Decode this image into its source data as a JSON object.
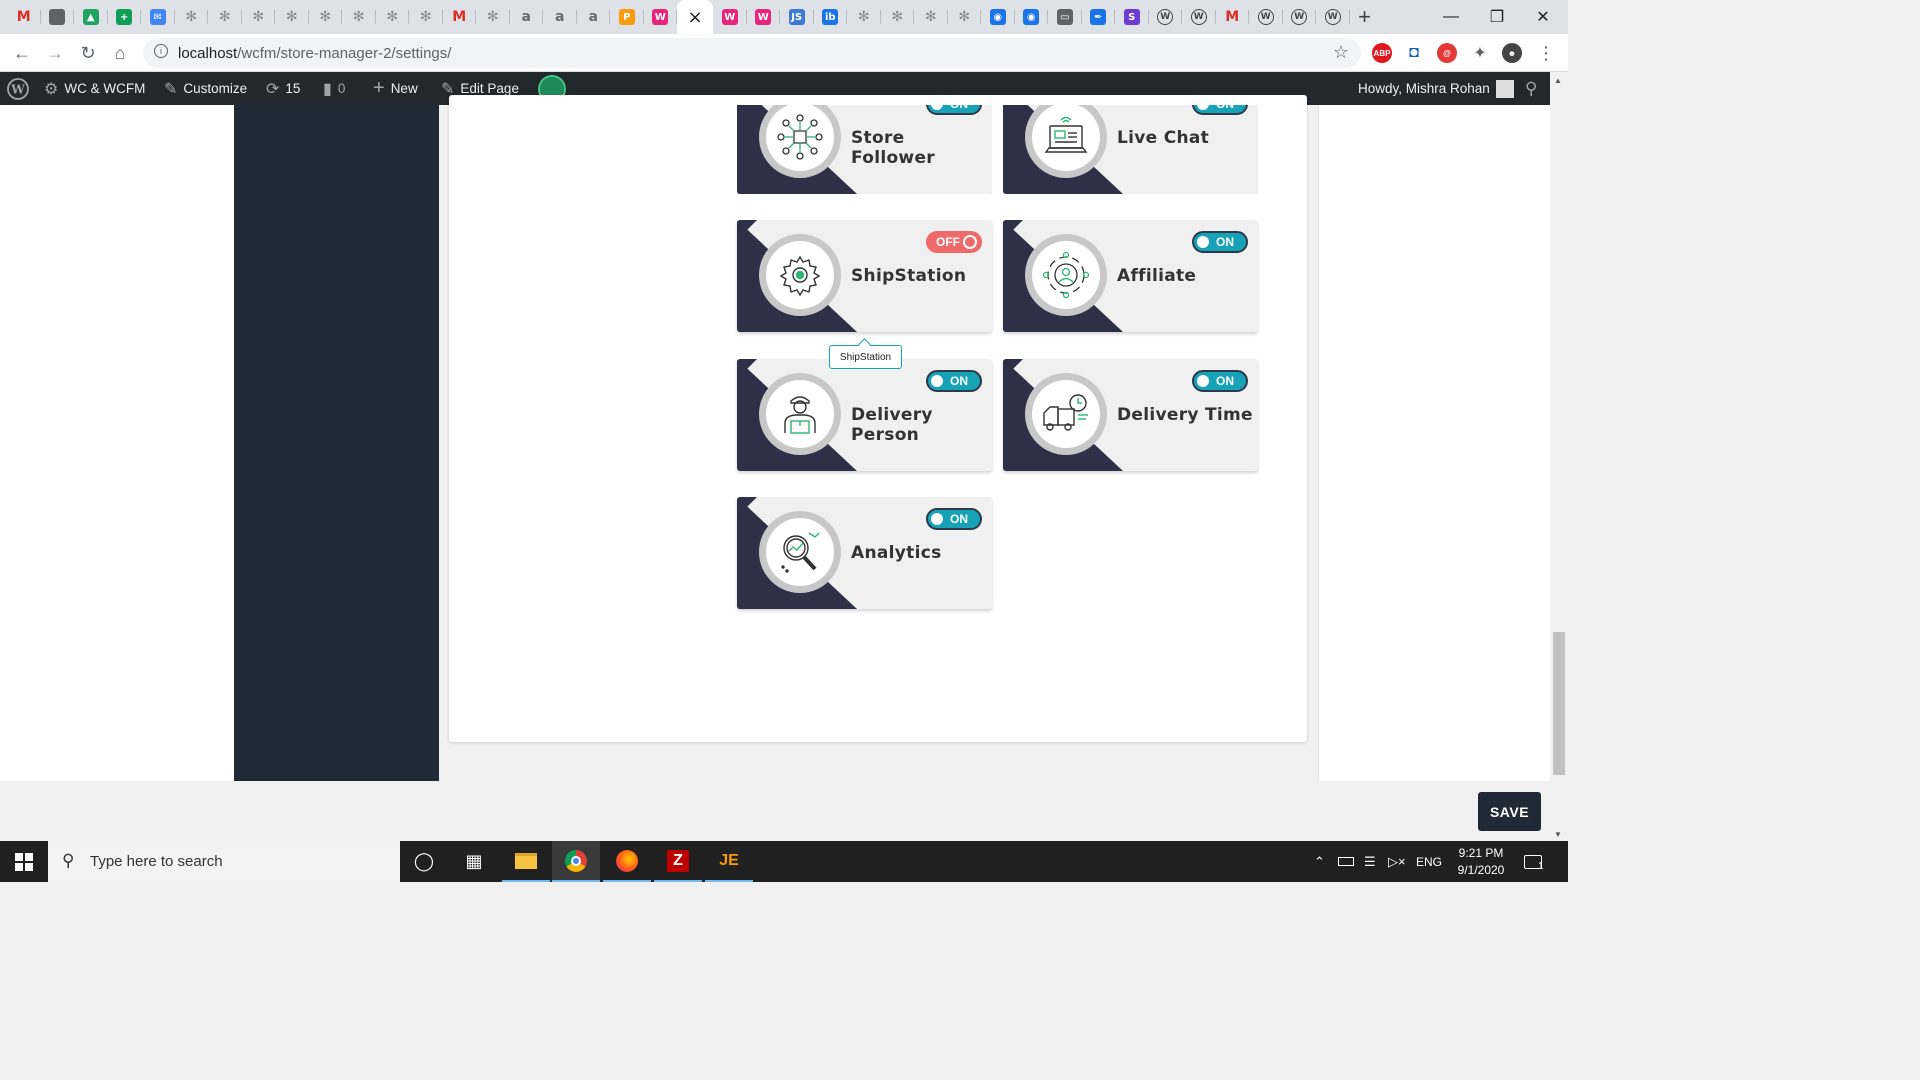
{
  "browser": {
    "tabs": [
      {
        "icon": "gmail-icon",
        "glyph": "M",
        "color": "#d93025"
      },
      {
        "icon": "circle-icon",
        "glyph": "",
        "color": "#5f6368"
      },
      {
        "icon": "drive-icon",
        "glyph": "▲",
        "color": "#1fa463"
      },
      {
        "icon": "sheets-icon",
        "glyph": "+",
        "color": "#0f9d58"
      },
      {
        "icon": "inbox-icon",
        "glyph": "✉",
        "color": "#4285f4"
      },
      {
        "icon": "site-icon",
        "glyph": "✻",
        "color": "#8b8b8b"
      },
      {
        "icon": "site-icon",
        "glyph": "✻",
        "color": "#8b8b8b"
      },
      {
        "icon": "site-icon",
        "glyph": "✻",
        "color": "#8b8b8b"
      },
      {
        "icon": "site-icon",
        "glyph": "✻",
        "color": "#8b8b8b"
      },
      {
        "icon": "site-icon",
        "glyph": "✻",
        "color": "#8b8b8b"
      },
      {
        "icon": "site-icon",
        "glyph": "✻",
        "color": "#8b8b8b"
      },
      {
        "icon": "site-icon",
        "glyph": "✻",
        "color": "#8b8b8b"
      },
      {
        "icon": "site-icon",
        "glyph": "✻",
        "color": "#8b8b8b"
      },
      {
        "icon": "gmail-icon",
        "glyph": "M",
        "color": "#d93025"
      },
      {
        "icon": "site-icon",
        "glyph": "✻",
        "color": "#8b8b8b"
      },
      {
        "icon": "script-a-icon",
        "glyph": "a",
        "color": "#6b6b6b"
      },
      {
        "icon": "script-a-icon",
        "glyph": "a",
        "color": "#6b6b6b"
      },
      {
        "icon": "script-a-icon",
        "glyph": "a",
        "color": "#6b6b6b"
      },
      {
        "icon": "phpmyadmin-icon",
        "glyph": "P",
        "color": "#f89c0e"
      },
      {
        "icon": "woo-icon",
        "glyph": "W",
        "color": "#e6267a"
      },
      {
        "icon": "close-icon",
        "glyph": "×",
        "color": "#202124",
        "active": true
      },
      {
        "icon": "woo-icon",
        "glyph": "W",
        "color": "#e6267a"
      },
      {
        "icon": "woo-icon",
        "glyph": "W",
        "color": "#e6267a"
      },
      {
        "icon": "js-icon",
        "glyph": "JS",
        "color": "#3c78d8"
      },
      {
        "icon": "ibb-icon",
        "glyph": "ib",
        "color": "#1a73e8"
      },
      {
        "icon": "site-icon",
        "glyph": "✻",
        "color": "#8b8b8b"
      },
      {
        "icon": "site-icon",
        "glyph": "✻",
        "color": "#8b8b8b"
      },
      {
        "icon": "site-icon",
        "glyph": "✻",
        "color": "#8b8b8b"
      },
      {
        "icon": "site-icon",
        "glyph": "✻",
        "color": "#8b8b8b"
      },
      {
        "icon": "globe-icon",
        "glyph": "◉",
        "color": "#1a73e8"
      },
      {
        "icon": "globe-icon",
        "glyph": "◉",
        "color": "#1a73e8"
      },
      {
        "icon": "screen-icon",
        "glyph": "▭",
        "color": "#5f6368"
      },
      {
        "icon": "feather-icon",
        "glyph": "✒",
        "color": "#1a73e8"
      },
      {
        "icon": "s-icon",
        "glyph": "S",
        "color": "#6c3bd1"
      },
      {
        "icon": "wordpress-icon",
        "glyph": "W",
        "color": "#464646"
      },
      {
        "icon": "wordpress-icon",
        "glyph": "W",
        "color": "#464646"
      },
      {
        "icon": "gmail-icon",
        "glyph": "M",
        "color": "#d93025"
      },
      {
        "icon": "wordpress-icon",
        "glyph": "W",
        "color": "#464646"
      },
      {
        "icon": "wordpress-icon",
        "glyph": "W",
        "color": "#464646"
      },
      {
        "icon": "wordpress-icon",
        "glyph": "W",
        "color": "#464646"
      }
    ],
    "url_host": "localhost",
    "url_path": "/wcfm/store-manager-2/settings/",
    "extensions": [
      {
        "icon": "adblock-icon",
        "glyph": "ABP",
        "color": "#e0181d"
      },
      {
        "icon": "camera-icon",
        "glyph": "◘",
        "color": "#1565c0"
      },
      {
        "icon": "spiral-icon",
        "glyph": "@",
        "color": "#e53935"
      },
      {
        "icon": "puzzle-icon",
        "glyph": "✦",
        "color": "#5f6368"
      },
      {
        "icon": "profile-avatar-icon",
        "glyph": "☻",
        "color": "#444"
      }
    ]
  },
  "adminbar": {
    "site": "WC & WCFM",
    "customize": "Customize",
    "updates": "15",
    "comments": "0",
    "new": "New",
    "edit": "Edit Page",
    "howdy": "Howdy, Mishra Rohan"
  },
  "modules": [
    {
      "title": "Store Follower",
      "state": "ON",
      "icon": "store-follower-icon"
    },
    {
      "title": "Live Chat",
      "state": "ON",
      "icon": "live-chat-icon"
    },
    {
      "title": "ShipStation",
      "state": "OFF",
      "icon": "shipstation-gear-icon"
    },
    {
      "title": "Affiliate",
      "state": "ON",
      "icon": "affiliate-icon"
    },
    {
      "title": "Delivery Person",
      "state": "ON",
      "icon": "delivery-person-icon"
    },
    {
      "title": "Delivery Time",
      "state": "ON",
      "icon": "delivery-time-icon"
    },
    {
      "title": "Analytics",
      "state": "ON",
      "icon": "analytics-icon"
    }
  ],
  "tooltip": "ShipStation",
  "save_label": "SAVE",
  "taskbar": {
    "search_placeholder": "Type here to search",
    "lang": "ENG",
    "time": "9:21 PM",
    "date": "9/1/2020",
    "notifications": "1"
  },
  "colors": {
    "on": "#17a2b8",
    "off": "#ef6a6a",
    "card_corner": "#2d3047",
    "sidebar": "#1f2a36"
  }
}
